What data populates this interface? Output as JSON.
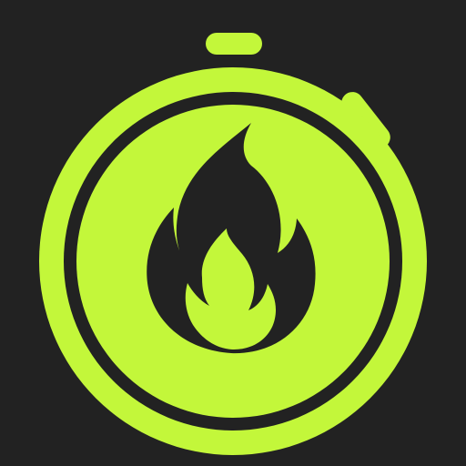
{
  "app_icon": {
    "icon_name": "stopwatch-fire-icon",
    "colors": {
      "background": "#222222",
      "accent": "#C3F73A",
      "flame_outer": "#222222",
      "flame_inner": "#C3F73A"
    }
  }
}
